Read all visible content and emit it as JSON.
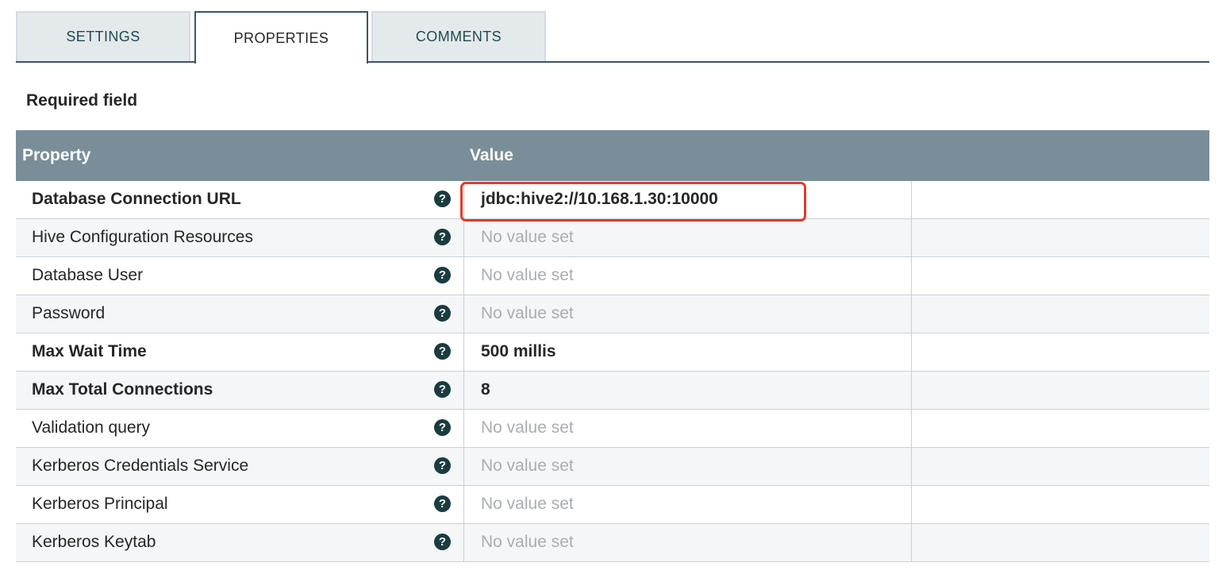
{
  "tabs": [
    {
      "label": "SETTINGS"
    },
    {
      "label": "PROPERTIES"
    },
    {
      "label": "COMMENTS"
    }
  ],
  "required_label": "Required field",
  "table": {
    "headers": {
      "property": "Property",
      "value": "Value"
    },
    "rows": [
      {
        "name": "Database Connection URL",
        "value": "jdbc:hive2://10.168.1.30:10000"
      },
      {
        "name": "Hive Configuration Resources",
        "value": "No value set"
      },
      {
        "name": "Database User",
        "value": "No value set"
      },
      {
        "name": "Password",
        "value": "No value set"
      },
      {
        "name": "Max Wait Time",
        "value": "500 millis"
      },
      {
        "name": "Max Total Connections",
        "value": "8"
      },
      {
        "name": "Validation query",
        "value": "No value set"
      },
      {
        "name": "Kerberos Credentials Service",
        "value": "No value set"
      },
      {
        "name": "Kerberos Principal",
        "value": "No value set"
      },
      {
        "name": "Kerberos Keytab",
        "value": "No value set"
      }
    ]
  },
  "help_icon_glyph": "?",
  "colors": {
    "header_bg": "#7a8e9a",
    "tab_active_border": "#3d5566",
    "help_icon": "#1a3c3f",
    "highlight": "#e03a2a"
  }
}
